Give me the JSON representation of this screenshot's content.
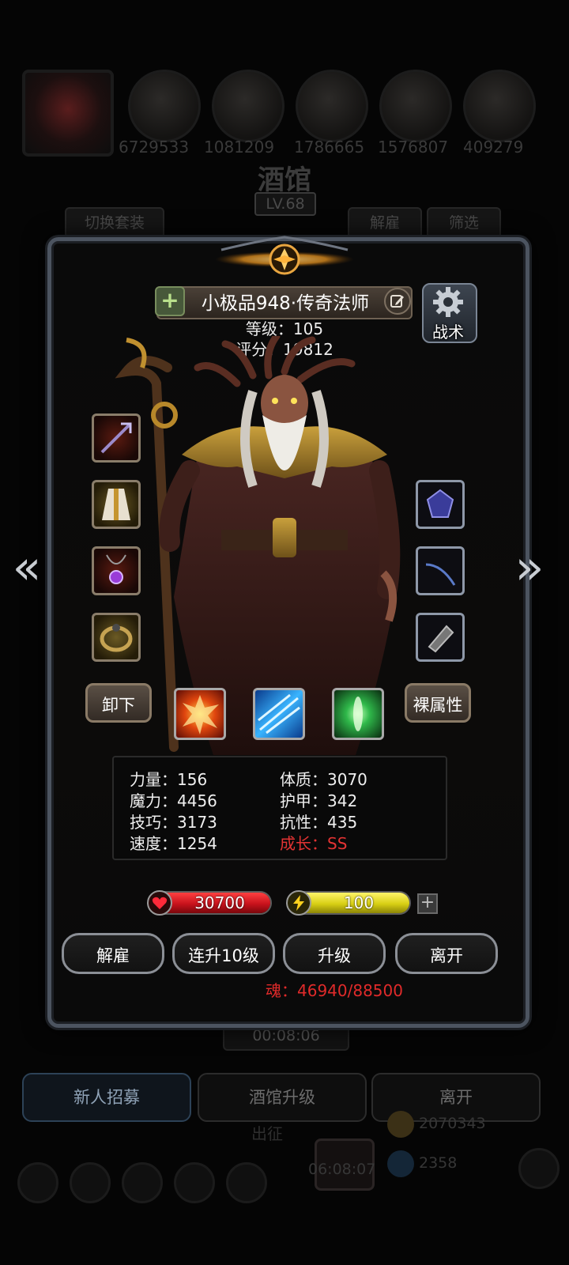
{
  "background": {
    "top_numbers": [
      "6729533",
      "1081209",
      "1786665",
      "1576807",
      "409279"
    ],
    "title": "酒馆",
    "level": "LV.68",
    "tab_switch_set": "切换套装",
    "tab_dismiss": "解雇",
    "tab_filter": "筛选",
    "timer": "00:08:06",
    "buttons": {
      "recruit": "新人招募",
      "upgrade_tavern": "酒馆升级",
      "leave": "离开"
    },
    "expedition": "出征",
    "gold": "2070343",
    "gems": "2358",
    "bottom_timer": "06:08:07"
  },
  "hero": {
    "name": "小极品948·传奇法师",
    "level_line": "等级：105",
    "score_line": "评分：19812",
    "tactics_label": "战术"
  },
  "equipment": {
    "left": [
      "staff",
      "robe",
      "amulet",
      "ring"
    ],
    "right": [
      "gem",
      "whip",
      "bracer"
    ]
  },
  "buttons": {
    "unequip": "卸下",
    "naked_attributes": "裸属性",
    "dismiss": "解雇",
    "level_up_10": "连升10级",
    "upgrade": "升级",
    "leave": "离开"
  },
  "skills": [
    "fire",
    "frost",
    "nature"
  ],
  "attributes": {
    "strength": "力量：156",
    "constitution": "体质：3070",
    "magic": "魔力：4456",
    "armor": "护甲：342",
    "skill": "技巧：3173",
    "resistance": "抗性：435",
    "speed": "速度：1254",
    "growth": "成长：SS"
  },
  "bars": {
    "hp": "30700",
    "energy": "100"
  },
  "soul": "魂：46940/88500",
  "colors": {
    "hp_fill": "#c8121c",
    "energy_fill": "#d8cf14",
    "growth_text": "#e33333",
    "soul_text": "#e02a2a"
  }
}
